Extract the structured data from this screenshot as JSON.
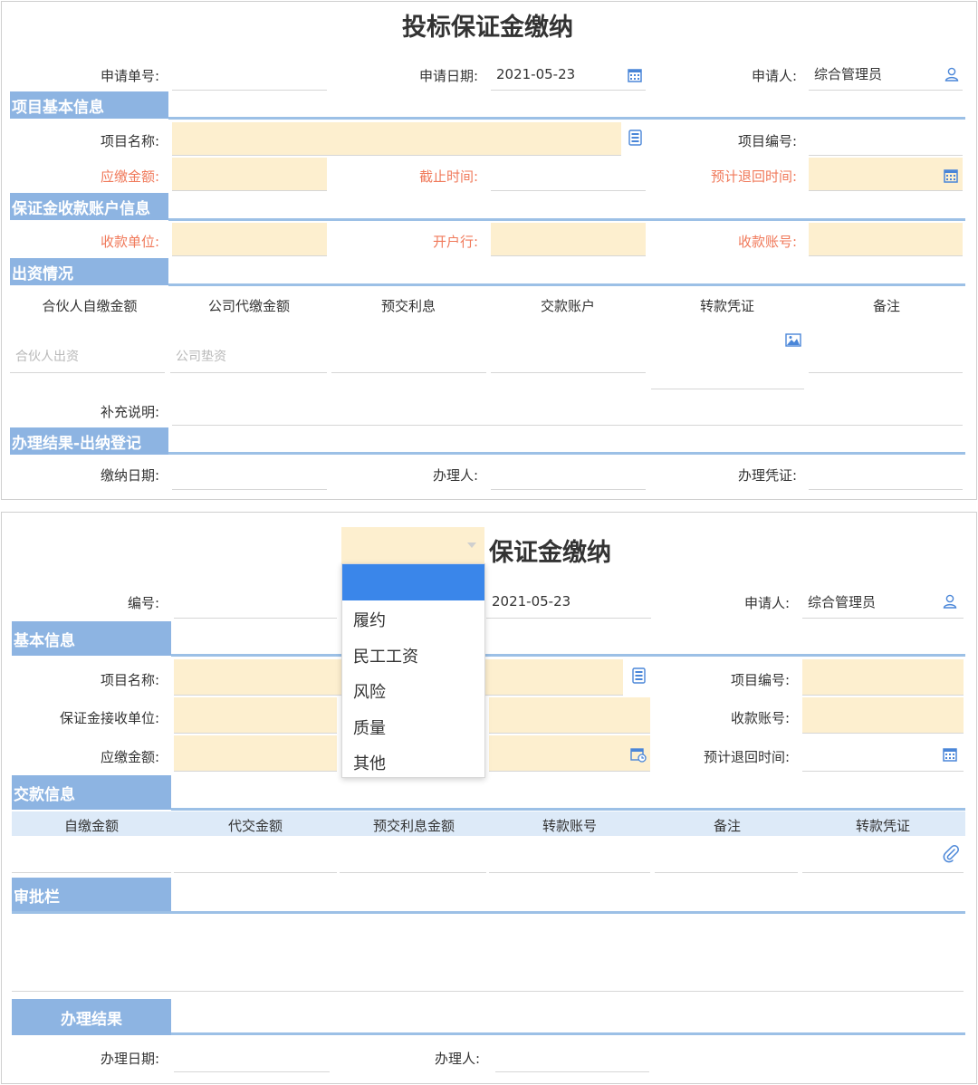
{
  "form1": {
    "title": "投标保证金缴纳",
    "labels": {
      "apply_no": "申请单号:",
      "apply_date": "申请日期:",
      "applicant": "申请人:",
      "project_name": "项目名称:",
      "project_no": "项目编号:",
      "amount_due": "应缴金额:",
      "deadline": "截止时间:",
      "expected_return": "预计退回时间:",
      "receiver": "收款单位:",
      "bank": "开户行:",
      "account_no": "收款账号:",
      "remark": "补充说明:",
      "pay_date": "缴纳日期:",
      "handler": "办理人:",
      "voucher": "办理凭证:"
    },
    "values": {
      "apply_date": "2021-05-23",
      "applicant": "综合管理员"
    },
    "sections": {
      "basic": "项目基本信息",
      "account": "保证金收款账户信息",
      "funding": "出资情况",
      "result": "办理结果-出纳登记"
    },
    "columns": [
      "合伙人自缴金额",
      "公司代缴金额",
      "预交利息",
      "交款账户",
      "转款凭证",
      "备注"
    ],
    "placeholders": {
      "partner": "合伙人出资",
      "company": "公司垫资"
    }
  },
  "form2": {
    "title": "保证金缴纳",
    "labels": {
      "no": "编号:",
      "applicant": "申请人:",
      "project_name": "项目名称:",
      "project_no": "项目编号:",
      "receiver": "保证金接收单位:",
      "account_no": "收款账号:",
      "amount_due": "应缴金额:",
      "expected_return": "预计退回时间:",
      "handle_date": "办理日期:",
      "handler": "办理人:"
    },
    "values": {
      "date": "2021-05-23",
      "applicant": "综合管理员"
    },
    "sections": {
      "basic": "基本信息",
      "payment": "交款信息",
      "approval": "审批栏",
      "result": "办理结果"
    },
    "columns": [
      "自缴金额",
      "代交金额",
      "预交利息金额",
      "转款账号",
      "备注",
      "转款凭证"
    ],
    "dropdown_options": [
      "履约",
      "民工工资",
      "风险",
      "质量",
      "其他"
    ]
  },
  "colors": {
    "section": "#8db4e2",
    "required_label": "#f0795a",
    "input_fill": "#fdefcf",
    "selected_option": "#3a86ea",
    "icon": "#4a86d8"
  }
}
